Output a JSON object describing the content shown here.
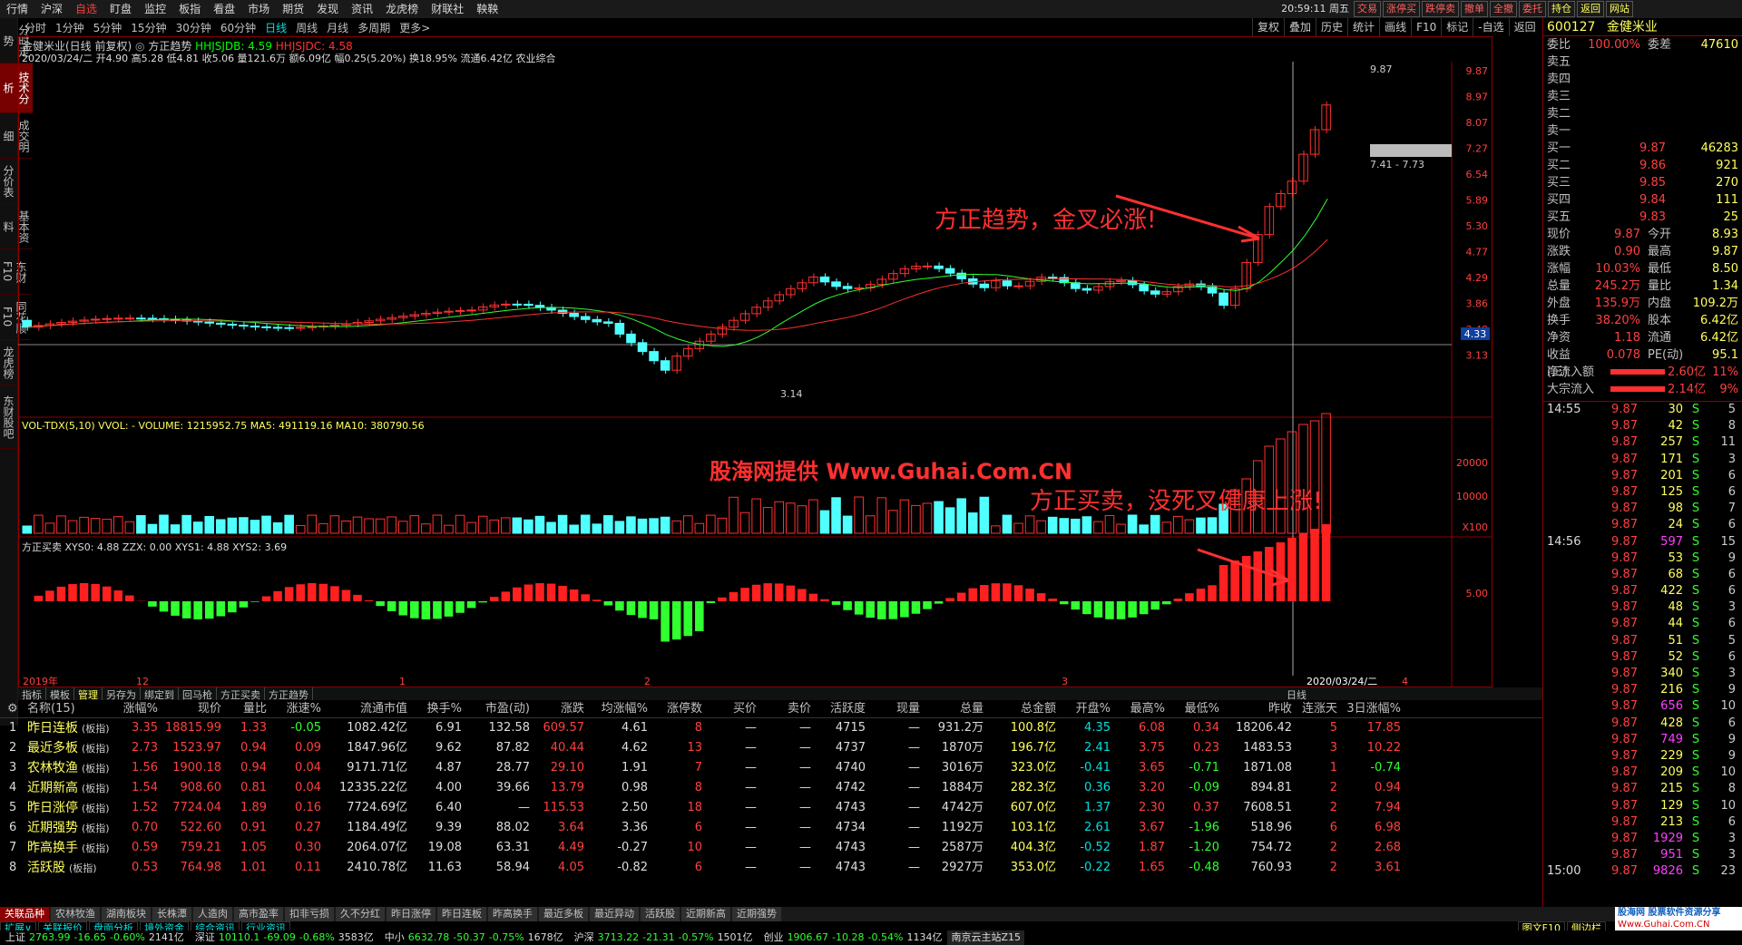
{
  "menu": [
    "行情",
    "沪深",
    "自选",
    "盯盘",
    "监控",
    "板指",
    "看盘",
    "市场",
    "期货",
    "发现",
    "资讯",
    "龙虎榜",
    "财联社",
    "鞅鞅"
  ],
  "menu_active": 2,
  "clock": "20:59:11 周五",
  "top_buttons": [
    "交易",
    "涨停买",
    "跌停卖",
    "撤单",
    "全撤",
    "委托",
    "持仓",
    "返回",
    "网站"
  ],
  "periods": [
    "分时",
    "1分钟",
    "5分钟",
    "15分钟",
    "30分钟",
    "60分钟",
    "日线",
    "周线",
    "月线",
    "多周期",
    "更多>"
  ],
  "period_sel": 6,
  "right_tools": [
    "复权",
    "叠加",
    "历史",
    "统计",
    "画线",
    "F10",
    "标记",
    "-自选",
    "返回"
  ],
  "left_tabs": [
    "分时走势",
    "技术分析",
    "成交明细",
    "分价表",
    "基本资料",
    "东财F10",
    "同花顺F10",
    "龙虎榜",
    "东财股吧"
  ],
  "left_sel": 1,
  "chart_title": "金健米业(日线 前复权)",
  "indicator_main": "方正趋势",
  "hhjsjdb": "HHJSJDB: 4.59",
  "hhjsjdc": "HHJSJDC: 4.58",
  "info_line": "2020/03/24/二 开4.90 高5.28 低4.81 收5.06 量121.6万 额6.09亿 幅0.25(5.20%) 换18.95% 流通6.42亿 农业综合",
  "price_axis": [
    "9.87",
    "8.97",
    "8.07",
    "7.27",
    "6.54",
    "5.89",
    "5.30",
    "4.77",
    "4.29",
    "3.86",
    "3.48",
    "3.13"
  ],
  "vol_header": "VOL-TDX(5,10)  VVOL: -   VOLUME: 1215952.75  MA5: 491119.16  MA10: 380790.56",
  "vol_axis": [
    "20000",
    "10000",
    "X100"
  ],
  "xy_header": "方正买卖  XYS0: 4.88   ZZX: 0.00   XYS1: 4.88  XYS2: 3.69",
  "xy_axis": [
    "5.00"
  ],
  "date_axis": [
    "2019年",
    "12",
    "1",
    "2",
    "3",
    "2020/03/24/二",
    "4"
  ],
  "annot1": "方正趋势，金叉必涨!",
  "annot2": "股海网提供 Www.Guhai.Com.CN",
  "annot3": "方正买卖，没死叉健康上涨!",
  "range_label": "7.41 - 7.73",
  "high_label": "9.87",
  "low_label": "3.14",
  "cur_price": "4.33",
  "ktabs": [
    "指标",
    "模板",
    "管理",
    "另存为",
    "绑定到",
    "回马枪",
    "方正买卖",
    "方正趋势"
  ],
  "ktab_right": "日线",
  "stock_code": "600127",
  "stock_name": "金健米业",
  "weibi": [
    "委比",
    "100.00%",
    "委差",
    "47610"
  ],
  "sells": [
    [
      "卖五",
      "",
      ""
    ],
    [
      "卖四",
      "",
      ""
    ],
    [
      "卖三",
      "",
      ""
    ],
    [
      "卖二",
      "",
      ""
    ],
    [
      "卖一",
      "",
      ""
    ]
  ],
  "buys": [
    [
      "买一",
      "9.87",
      "46283"
    ],
    [
      "买二",
      "9.86",
      "921"
    ],
    [
      "买三",
      "9.85",
      "270"
    ],
    [
      "买四",
      "9.84",
      "111"
    ],
    [
      "买五",
      "9.83",
      "25"
    ]
  ],
  "stats": [
    [
      "现价",
      "9.87",
      "今开",
      "8.93"
    ],
    [
      "涨跌",
      "0.90",
      "最高",
      "9.87"
    ],
    [
      "涨幅",
      "10.03%",
      "最低",
      "8.50"
    ],
    [
      "总量",
      "245.2万",
      "量比",
      "1.34"
    ],
    [
      "外盘",
      "135.9万",
      "内盘",
      "109.2万"
    ],
    [
      "换手",
      "38.20%",
      "股本",
      "6.42亿"
    ],
    [
      "净资",
      "1.18",
      "流通",
      "6.42亿"
    ],
    [
      "收益(三)",
      "0.078",
      "PE(动)",
      "95.1"
    ]
  ],
  "flow": [
    [
      "净流入额",
      "2.60亿",
      "11%"
    ],
    [
      "大宗流入",
      "2.14亿",
      "9%"
    ]
  ],
  "ticks_time1": "14:55",
  "ticks_time2": "14:56",
  "ticks_time3": "15:00",
  "ticks": [
    [
      "9.87",
      "30",
      "S",
      "5"
    ],
    [
      "9.87",
      "42",
      "S",
      "8"
    ],
    [
      "9.87",
      "257",
      "S",
      "11"
    ],
    [
      "9.87",
      "171",
      "S",
      "3"
    ],
    [
      "9.87",
      "201",
      "S",
      "6"
    ],
    [
      "9.87",
      "125",
      "S",
      "6"
    ],
    [
      "9.87",
      "98",
      "S",
      "7"
    ],
    [
      "9.87",
      "24",
      "S",
      "6"
    ],
    [
      "9.87",
      "597",
      "S",
      "15"
    ],
    [
      "9.87",
      "53",
      "S",
      "9"
    ],
    [
      "9.87",
      "68",
      "S",
      "6"
    ],
    [
      "9.87",
      "422",
      "S",
      "6"
    ],
    [
      "9.87",
      "48",
      "S",
      "3"
    ],
    [
      "9.87",
      "44",
      "S",
      "6"
    ],
    [
      "9.87",
      "51",
      "S",
      "5"
    ],
    [
      "9.87",
      "52",
      "S",
      "6"
    ],
    [
      "9.87",
      "340",
      "S",
      "3"
    ],
    [
      "9.87",
      "216",
      "S",
      "9"
    ],
    [
      "9.87",
      "656",
      "S",
      "10"
    ],
    [
      "9.87",
      "428",
      "S",
      "6"
    ],
    [
      "9.87",
      "749",
      "S",
      "9"
    ],
    [
      "9.87",
      "229",
      "S",
      "9"
    ],
    [
      "9.87",
      "209",
      "S",
      "10"
    ],
    [
      "9.87",
      "215",
      "S",
      "8"
    ],
    [
      "9.87",
      "129",
      "S",
      "10"
    ],
    [
      "9.87",
      "213",
      "S",
      "6"
    ],
    [
      "9.87",
      "1929",
      "S",
      "3"
    ],
    [
      "9.87",
      "951",
      "S",
      "3"
    ],
    [
      "9.87",
      "9826",
      "S",
      "23"
    ]
  ],
  "table_headers": [
    "名称(15)",
    "涨幅%",
    "现价",
    "量比",
    "涨速%",
    "流通市值",
    "换手%",
    "市盈(动)",
    "涨跌",
    "均涨幅%",
    "涨停数",
    "买价",
    "卖价",
    "活跃度",
    "现量",
    "总量",
    "总金额",
    "开盘%",
    "最高%",
    "最低%",
    "昨收",
    "连涨天",
    "3日涨幅%"
  ],
  "rows": [
    [
      "1",
      "昨日连板",
      "(板指)",
      "3.35",
      "18815.99",
      "1.33",
      "-0.05",
      "1082.42亿",
      "6.91",
      "132.58",
      "609.57",
      "4.61",
      "8",
      "—",
      "—",
      "4715",
      "—",
      "931.2万",
      "100.8亿",
      "4.35",
      "6.08",
      "0.34",
      "18206.42",
      "5",
      "17.85"
    ],
    [
      "2",
      "最近多板",
      "(板指)",
      "2.73",
      "1523.97",
      "0.94",
      "0.09",
      "1847.96亿",
      "9.62",
      "87.82",
      "40.44",
      "4.62",
      "13",
      "—",
      "—",
      "4737",
      "—",
      "1870万",
      "196.7亿",
      "2.41",
      "3.75",
      "0.23",
      "1483.53",
      "3",
      "10.22"
    ],
    [
      "3",
      "农林牧渔",
      "(板指)",
      "1.56",
      "1900.18",
      "0.94",
      "0.04",
      "9171.71亿",
      "4.87",
      "28.77",
      "29.10",
      "1.91",
      "7",
      "—",
      "—",
      "4740",
      "—",
      "3016万",
      "323.0亿",
      "-0.41",
      "3.65",
      "-0.71",
      "1871.08",
      "1",
      "-0.74"
    ],
    [
      "4",
      "近期新高",
      "(板指)",
      "1.54",
      "908.60",
      "0.81",
      "0.04",
      "12335.22亿",
      "4.00",
      "39.66",
      "13.79",
      "0.98",
      "8",
      "—",
      "—",
      "4742",
      "—",
      "1884万",
      "282.3亿",
      "0.36",
      "3.20",
      "-0.09",
      "894.81",
      "2",
      "0.94"
    ],
    [
      "5",
      "昨日涨停",
      "(板指)",
      "1.52",
      "7724.04",
      "1.89",
      "0.16",
      "7724.69亿",
      "6.40",
      "—",
      "115.53",
      "2.50",
      "18",
      "—",
      "—",
      "4743",
      "—",
      "4742万",
      "607.0亿",
      "1.37",
      "2.30",
      "0.37",
      "7608.51",
      "2",
      "7.94"
    ],
    [
      "6",
      "近期强势",
      "(板指)",
      "0.70",
      "522.60",
      "0.91",
      "0.27",
      "1184.49亿",
      "9.39",
      "88.02",
      "3.64",
      "3.36",
      "6",
      "—",
      "—",
      "4734",
      "—",
      "1192万",
      "103.1亿",
      "2.61",
      "3.67",
      "-1.96",
      "518.96",
      "6",
      "6.98"
    ],
    [
      "7",
      "昨高换手",
      "(板指)",
      "0.59",
      "759.21",
      "1.05",
      "0.30",
      "2064.07亿",
      "19.08",
      "63.31",
      "4.49",
      "-0.27",
      "10",
      "—",
      "—",
      "4743",
      "—",
      "2587万",
      "404.3亿",
      "-0.52",
      "1.87",
      "-1.20",
      "754.72",
      "2",
      "2.68"
    ],
    [
      "8",
      "活跃股",
      "(板指)",
      "0.53",
      "764.98",
      "1.01",
      "0.11",
      "2410.78亿",
      "11.63",
      "58.94",
      "4.05",
      "-0.82",
      "6",
      "—",
      "—",
      "4743",
      "—",
      "2927万",
      "353.0亿",
      "-0.22",
      "1.65",
      "-0.48",
      "760.93",
      "2",
      "3.61"
    ]
  ],
  "btabs": [
    "关联品种",
    "农林牧渔",
    "湖南板块",
    "长株潭",
    "人造肉",
    "高市盈率",
    "扣非亏损",
    "久不分红",
    "昨日涨停",
    "昨日连板",
    "昨高换手",
    "最近多板",
    "最近异动",
    "活跃股",
    "近期新高",
    "近期强势"
  ],
  "btabs2": [
    "扩展∨",
    "关联报价",
    "盘面分析",
    "境外资金",
    "综合资讯",
    "行业资讯"
  ],
  "btabs2_right": [
    "图文F10",
    "侧边栏"
  ],
  "status": [
    [
      "上证",
      "2763.99",
      "-16.65",
      "-0.60%",
      "2141亿"
    ],
    [
      "深证",
      "10110.1",
      "-69.09",
      "-0.68%",
      "3583亿"
    ],
    [
      "中小",
      "6632.78",
      "-50.37",
      "-0.75%",
      "1678亿"
    ],
    [
      "沪深",
      "3713.22",
      "-21.31",
      "-0.57%",
      "1501亿"
    ],
    [
      "创业",
      "1906.67",
      "-10.28",
      "-0.54%",
      "1134亿"
    ]
  ],
  "server": "南京云主站Z15",
  "logo": "股海网  股票软件资源分享",
  "logo_url": "Www.Guhai.Com.CN"
}
